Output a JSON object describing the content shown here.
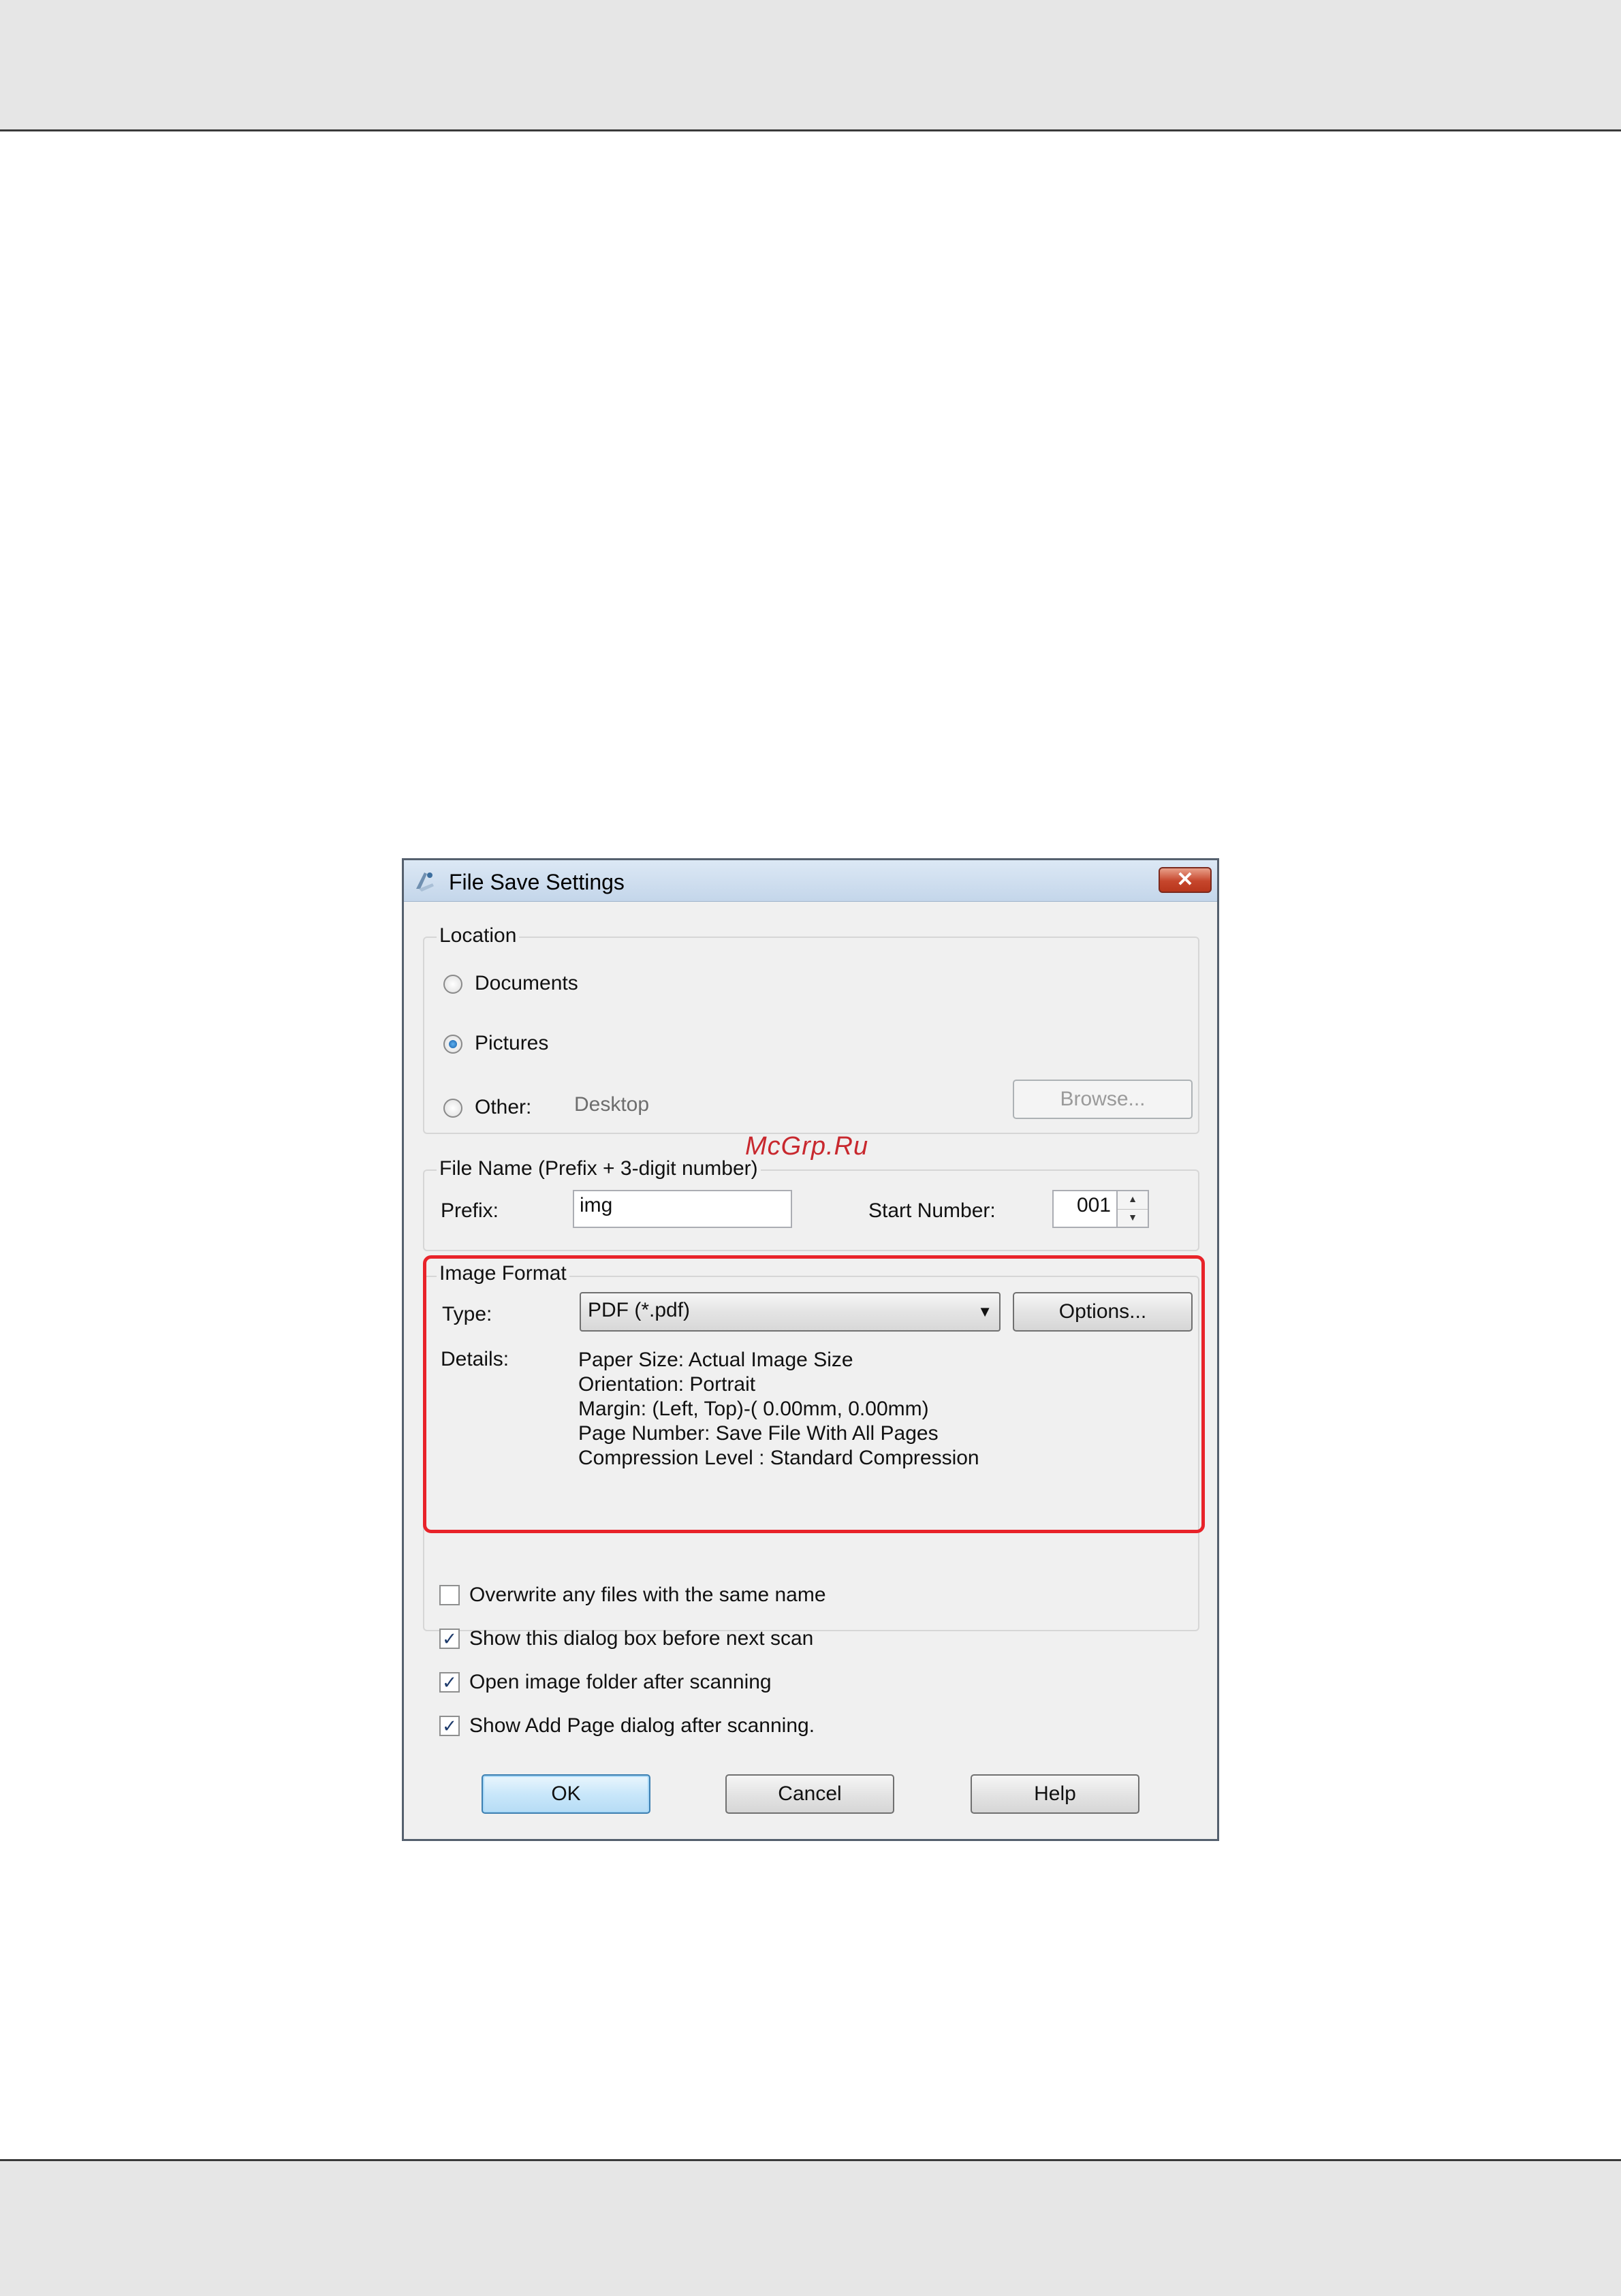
{
  "dialog": {
    "title": "File Save Settings",
    "close_glyph": "✕"
  },
  "location": {
    "title": "Location",
    "options": [
      {
        "label": "Documents",
        "selected": false
      },
      {
        "label": "Pictures",
        "selected": true
      },
      {
        "label": "Other:",
        "selected": false
      }
    ],
    "other_value": "Desktop",
    "browse_label": "Browse..."
  },
  "file_name": {
    "title": "File Name (Prefix + 3-digit number)",
    "prefix_label": "Prefix:",
    "prefix_value": "img",
    "start_number_label": "Start Number:",
    "start_number_value": "001"
  },
  "image_format": {
    "title": "Image Format",
    "type_label": "Type:",
    "type_value": "PDF (*.pdf)",
    "options_label": "Options...",
    "details_label": "Details:",
    "details": [
      "Paper Size: Actual Image Size",
      "Orientation: Portrait",
      "Margin: (Left, Top)-( 0.00mm, 0.00mm)",
      "Page Number: Save File With All Pages",
      "Compression Level : Standard Compression"
    ]
  },
  "checkboxes": [
    {
      "label": "Overwrite any files with the same name",
      "checked": false
    },
    {
      "label": "Show this dialog box before next scan",
      "checked": true
    },
    {
      "label": "Open image folder after scanning",
      "checked": true
    },
    {
      "label": "Show Add Page dialog after scanning.",
      "checked": true
    }
  ],
  "check_glyph": "✓",
  "buttons": {
    "ok": "OK",
    "cancel": "Cancel",
    "help": "Help"
  },
  "watermark": "McGrp.Ru",
  "colors": {
    "highlight": "#e8232a",
    "watermark": "#c8282e"
  }
}
